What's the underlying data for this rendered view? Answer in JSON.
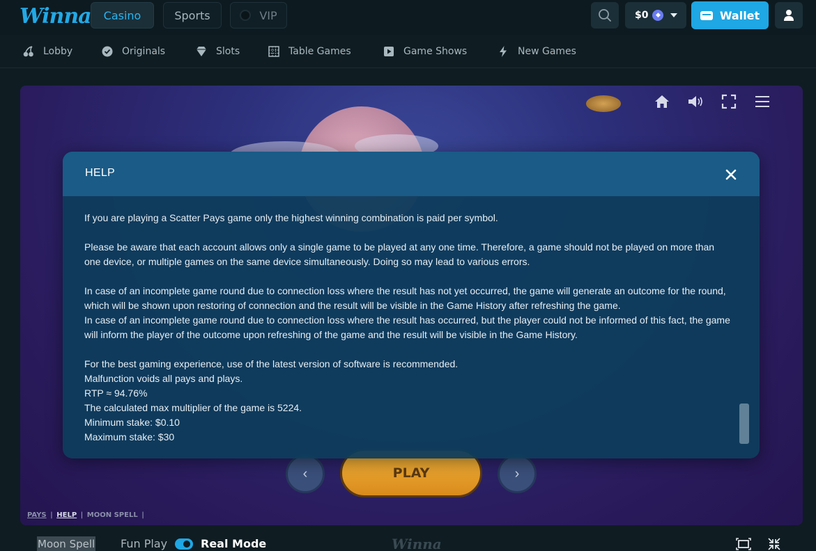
{
  "header": {
    "logo": "Winna",
    "nav": [
      {
        "label": "Casino",
        "active": true
      },
      {
        "label": "Sports",
        "active": false
      },
      {
        "label": "VIP",
        "active": false
      }
    ],
    "balance": "$0",
    "currency_icon": "ethereum-icon",
    "wallet_label": "Wallet"
  },
  "subnav": [
    {
      "label": "Lobby",
      "icon": "cherry-icon"
    },
    {
      "label": "Originals",
      "icon": "badge-check-icon"
    },
    {
      "label": "Slots",
      "icon": "diamond-icon"
    },
    {
      "label": "Table Games",
      "icon": "grid-icon"
    },
    {
      "label": "Game Shows",
      "icon": "play-icon"
    },
    {
      "label": "New Games",
      "icon": "lightning-icon"
    }
  ],
  "game": {
    "play_label": "PLAY",
    "links": [
      "PAYS",
      "HELP",
      "MOON SPELL"
    ],
    "separator": "|"
  },
  "help": {
    "title": "HELP",
    "paragraphs": [
      [
        "If you are playing a Scatter Pays game only the highest winning combination is paid per symbol."
      ],
      [
        "Please be aware that each account allows only a single game to be played at any one time. Therefore, a game should not be played on more than one device, or multiple games on the same device simultaneously. Doing so may lead to various errors."
      ],
      [
        "In case of an incomplete game round due to connection loss where the result has not yet occurred, the game will generate an outcome for the round, which will be shown upon restoring of connection and the result will be visible in the Game History after refreshing the game.",
        "In case of an incomplete game round due to connection loss where the result has occurred, but the player could not be informed of this fact, the game will inform the player of the outcome upon refreshing of the game and the result will be visible in the Game History."
      ],
      [
        "For the best gaming experience, use of the latest version of software is recommended.",
        "Malfunction voids all pays and plays.",
        "RTP ≈ 94.76%",
        "The calculated max multiplier of the game is 5224.",
        "Minimum stake: $0.10",
        "Maximum stake: $30"
      ]
    ]
  },
  "footer": {
    "game_name": "Moon Spell",
    "fun_play": "Fun Play",
    "real_mode": "Real Mode",
    "real_mode_on": true,
    "watermark": "Winna"
  },
  "colors": {
    "accent": "#1ea7e4",
    "background": "#0f1c22",
    "modal_header": "#1a5b87"
  }
}
